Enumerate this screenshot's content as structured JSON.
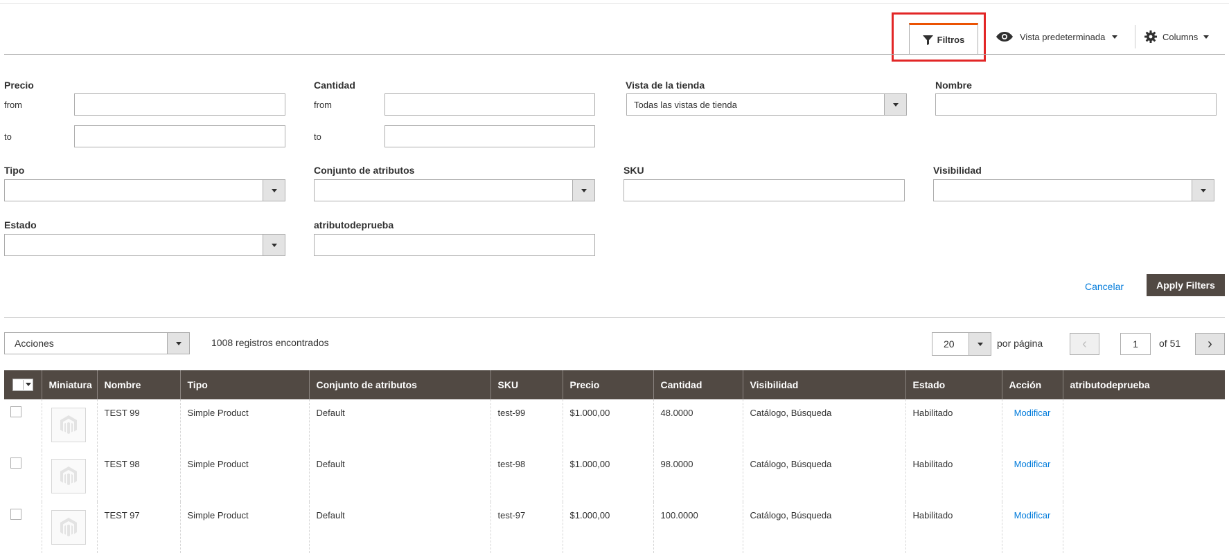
{
  "toolbar": {
    "filters_label": "Filtros",
    "view_label": "Vista predeterminada",
    "columns_label": "Columns"
  },
  "filters": {
    "precio": {
      "label": "Precio",
      "from_label": "from",
      "to_label": "to"
    },
    "cantidad": {
      "label": "Cantidad",
      "from_label": "from",
      "to_label": "to"
    },
    "vista_tienda": {
      "label": "Vista de la tienda",
      "value": "Todas las vistas de tienda"
    },
    "nombre": {
      "label": "Nombre"
    },
    "tipo": {
      "label": "Tipo"
    },
    "conjunto": {
      "label": "Conjunto de atributos"
    },
    "sku": {
      "label": "SKU"
    },
    "visibilidad": {
      "label": "Visibilidad"
    },
    "estado": {
      "label": "Estado"
    },
    "atributodeprueba": {
      "label": "atributodeprueba"
    },
    "cancel_label": "Cancelar",
    "apply_label": "Apply Filters"
  },
  "grid": {
    "actions_label": "Acciones",
    "records_text": "1008 registros encontrados",
    "per_page_value": "20",
    "per_page_label": "por página",
    "current_page": "1",
    "total_pages_text": "of 51",
    "columns": [
      "Miniatura",
      "Nombre",
      "Tipo",
      "Conjunto de atributos",
      "SKU",
      "Precio",
      "Cantidad",
      "Visibilidad",
      "Estado",
      "Acción",
      "atributodeprueba"
    ],
    "rows": [
      {
        "nombre": "TEST 99",
        "tipo": "Simple Product",
        "conjunto": "Default",
        "sku": "test-99",
        "precio": "$1.000,00",
        "cantidad": "48.0000",
        "visibilidad": "Catálogo, Búsqueda",
        "estado": "Habilitado",
        "accion": "Modificar",
        "atributo": ""
      },
      {
        "nombre": "TEST 98",
        "tipo": "Simple Product",
        "conjunto": "Default",
        "sku": "test-98",
        "precio": "$1.000,00",
        "cantidad": "98.0000",
        "visibilidad": "Catálogo, Búsqueda",
        "estado": "Habilitado",
        "accion": "Modificar",
        "atributo": ""
      },
      {
        "nombre": "TEST 97",
        "tipo": "Simple Product",
        "conjunto": "Default",
        "sku": "test-97",
        "precio": "$1.000,00",
        "cantidad": "100.0000",
        "visibilidad": "Catálogo, Búsqueda",
        "estado": "Habilitado",
        "accion": "Modificar",
        "atributo": ""
      }
    ]
  },
  "colors": {
    "accent": "#eb5202",
    "header_bg": "#514943",
    "link": "#007bdb",
    "highlight": "#e22626"
  }
}
